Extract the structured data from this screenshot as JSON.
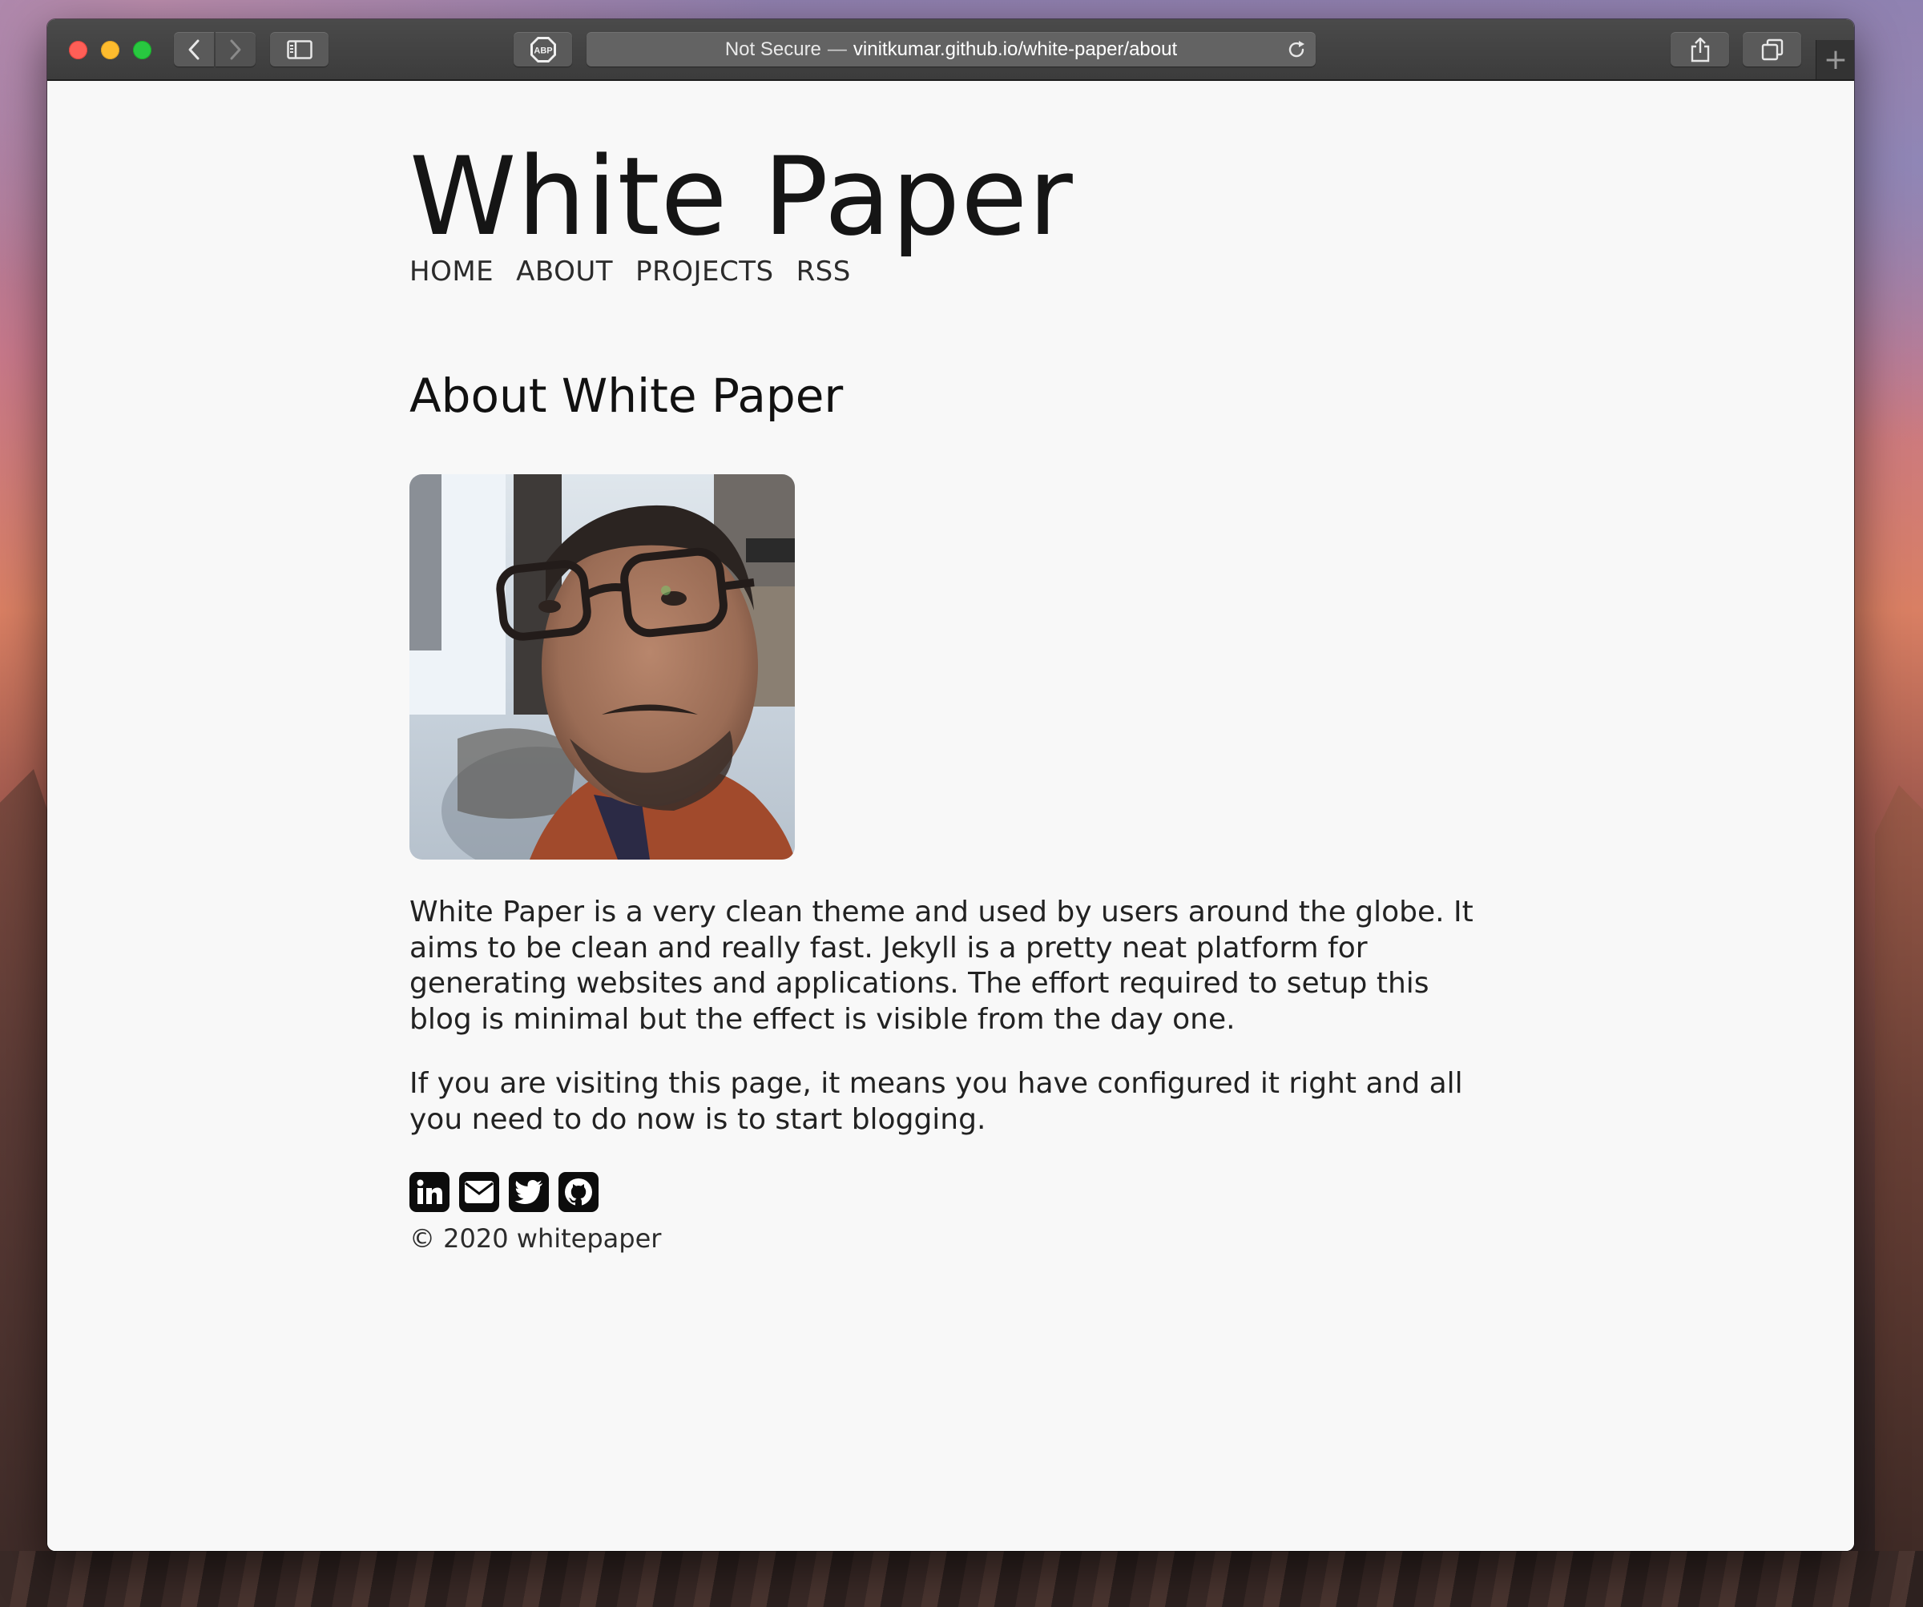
{
  "browser": {
    "address_security": "Not Secure",
    "address_separator": "—",
    "address_url": "vinitkumar.github.io/white-paper/about",
    "adblock_label": "ABP",
    "new_tab_glyph": "+"
  },
  "site": {
    "title": "White Paper",
    "nav": [
      {
        "label": "HOME"
      },
      {
        "label": "ABOUT"
      },
      {
        "label": "PROJECTS"
      },
      {
        "label": "RSS"
      }
    ]
  },
  "page": {
    "heading": "About White Paper",
    "paragraphs": [
      "White Paper is a very clean theme and used by users around the globe. It aims to be clean and really fast. Jekyll is a pretty neat platform for generating websites and applications. The effort required to setup this blog is minimal but the effect is visible from the day one.",
      "If you are visiting this page, it means you have configured it right and all you need to do now is to start blogging."
    ],
    "social_icons": [
      "linkedin-icon",
      "email-icon",
      "twitter-icon",
      "github-icon"
    ],
    "footer": "© 2020 whitepaper"
  },
  "colors": {
    "page_background": "#f8f8f8",
    "text": "#1b1b1b",
    "traffic_red": "#ff5f57",
    "traffic_yellow": "#febc2e",
    "traffic_green": "#28c840"
  }
}
